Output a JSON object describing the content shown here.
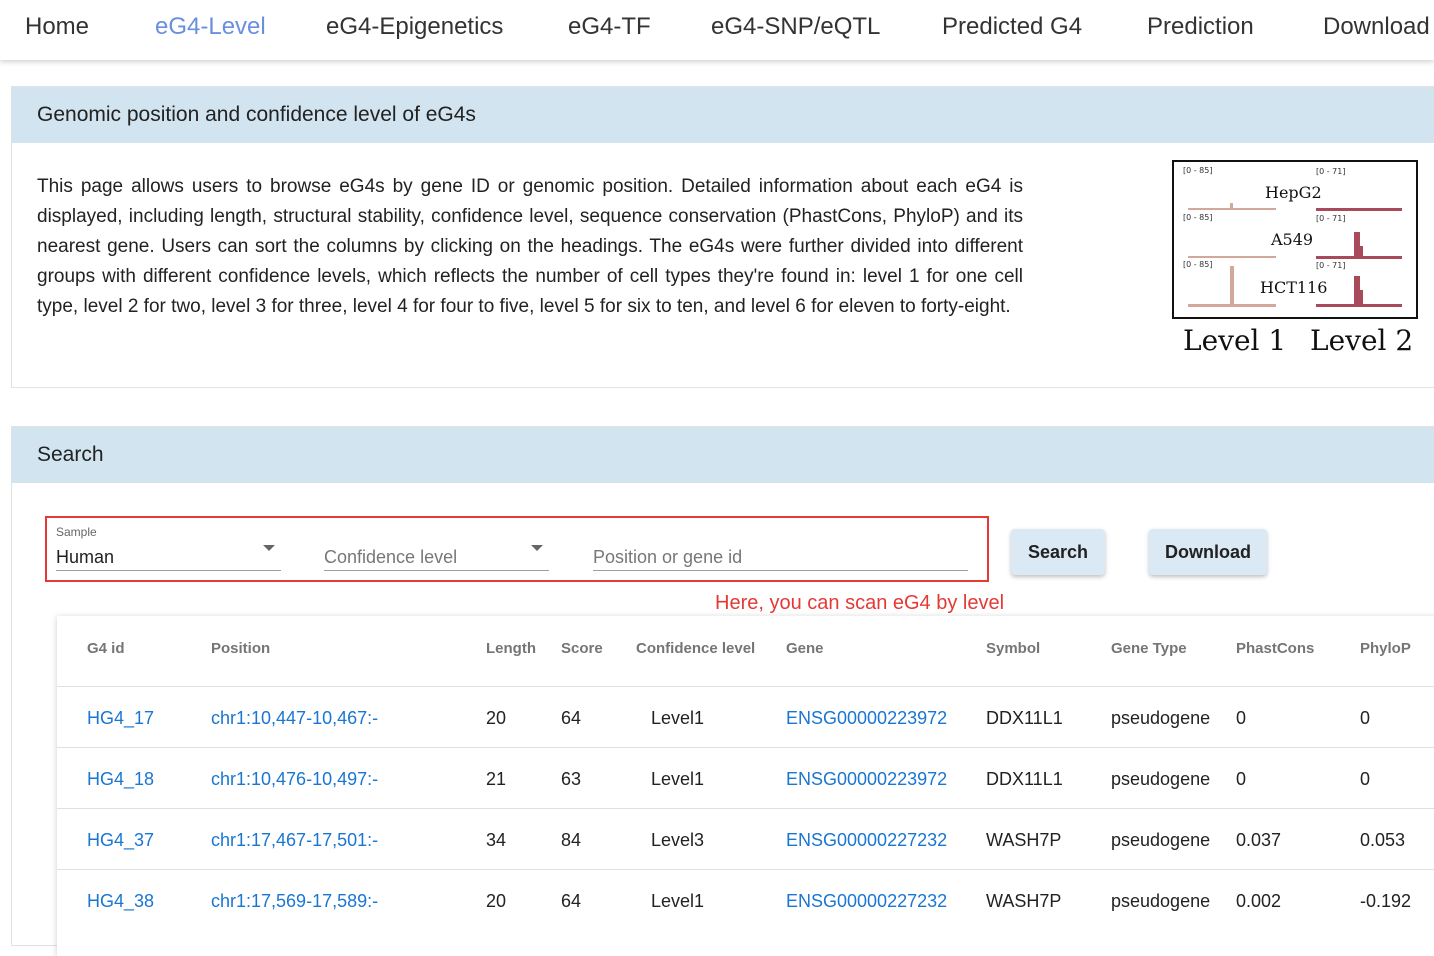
{
  "nav": {
    "items": [
      "Home",
      "eG4-Level",
      "eG4-Epigenetics",
      "eG4-TF",
      "eG4-SNP/eQTL",
      "Predicted G4",
      "Prediction",
      "Download"
    ],
    "active": "eG4-Level"
  },
  "info": {
    "title": "Genomic position and confidence level of eG4s",
    "description": "This page allows users to browse eG4s by gene ID or genomic position. Detailed information about each eG4 is displayed, including length, structural stability, confidence level, sequence conservation (PhastCons, PhyloP) and its nearest gene. Users can sort the columns by clicking on the headings. The eG4s were further divided into different groups with different confidence levels, which reflects the number of cell types they're found in: level 1 for one cell type, level 2 for two, level 3 for three, level 4 for four to five, level 5 for six to ten, and level 6 for eleven to forty-eight.",
    "figure": {
      "cell_lines": [
        "HepG2",
        "A549",
        "HCT116"
      ],
      "range_left": "[0 - 85]",
      "range_right": "[0 - 71]",
      "level_labels": [
        "Level 1",
        "Level 2"
      ],
      "colors": {
        "level1": "#d4a79d",
        "level2": "#a84a5a"
      }
    }
  },
  "search": {
    "title": "Search",
    "sample_label": "Sample",
    "sample_value": "Human",
    "confidence_placeholder": "Confidence level",
    "position_placeholder": "Position or gene id",
    "search_button": "Search",
    "download_button": "Download",
    "annotation": "Here, you can scan eG4 by level"
  },
  "table": {
    "headers": [
      "G4 id",
      "Position",
      "Length",
      "Score",
      "Confidence level",
      "Gene",
      "Symbol",
      "Gene Type",
      "PhastCons",
      "PhyloP"
    ],
    "rows": [
      [
        "HG4_17",
        "chr1:10,447-10,467:-",
        "20",
        "64",
        "Level1",
        "ENSG00000223972",
        "DDX11L1",
        "pseudogene",
        "0",
        "0"
      ],
      [
        "HG4_18",
        "chr1:10,476-10,497:-",
        "21",
        "63",
        "Level1",
        "ENSG00000223972",
        "DDX11L1",
        "pseudogene",
        "0",
        "0"
      ],
      [
        "HG4_37",
        "chr1:17,467-17,501:-",
        "34",
        "84",
        "Level3",
        "ENSG00000227232",
        "WASH7P",
        "pseudogene",
        "0.037",
        "0.053"
      ],
      [
        "HG4_38",
        "chr1:17,569-17,589:-",
        "20",
        "64",
        "Level1",
        "ENSG00000227232",
        "WASH7P",
        "pseudogene",
        "0.002",
        "-0.192"
      ]
    ]
  },
  "colors": {
    "header_band": "#d1e4ef",
    "link": "#1976d2",
    "active_nav": "#6a8fe0",
    "annotation": "#e53935",
    "button": "#dbe9f4"
  }
}
